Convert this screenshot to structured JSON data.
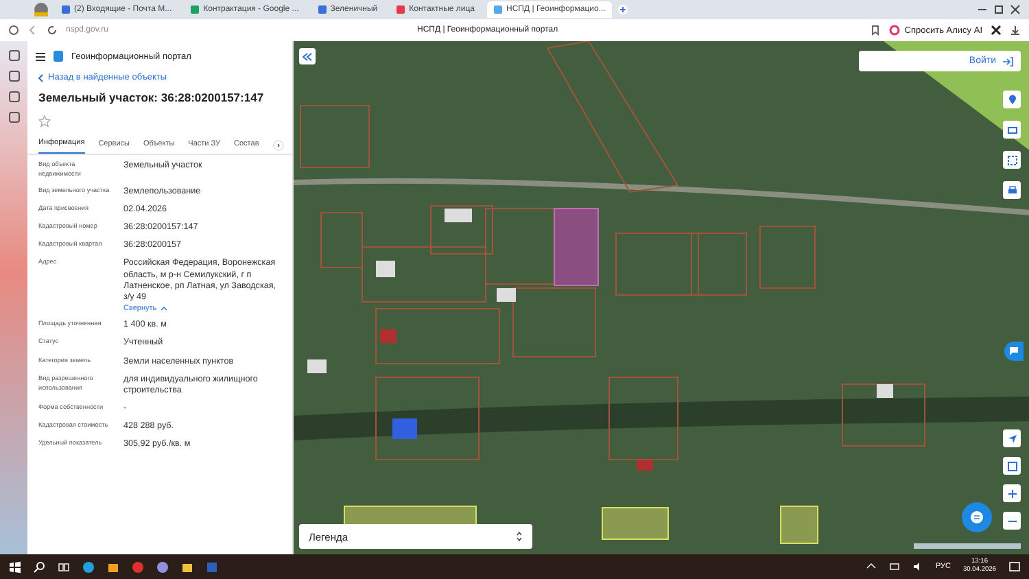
{
  "browser": {
    "tabs": [
      {
        "label": "(2) Входящие - Почта М...",
        "selected": false
      },
      {
        "label": "Контрактация - Google ...",
        "selected": false
      },
      {
        "label": "Зеленичный",
        "selected": false
      },
      {
        "label": "Контактные лица",
        "selected": false
      },
      {
        "label": "НСПД | Геоинформацио...",
        "selected": true
      }
    ],
    "address": "nspd.gov.ru",
    "page_title": "НСПД | Геоинформационный портал",
    "alice_button": "Спросить Алису AI"
  },
  "panel": {
    "portal_title": "Геоинформационный портал",
    "back_link": "Назад в найденные объекты",
    "heading": "Земельный участок: 36:28:0200157:147",
    "favorite": false,
    "tabs": [
      {
        "label": "Информация",
        "selected": true
      },
      {
        "label": "Сервисы",
        "selected": false
      },
      {
        "label": "Объекты",
        "selected": false
      },
      {
        "label": "Части ЗУ",
        "selected": false
      },
      {
        "label": "Состав",
        "selected": false
      }
    ],
    "fields": [
      {
        "label": "Вид объекта недвижимости",
        "value": "Земельный участок"
      },
      {
        "label": "Вид земельного участка",
        "value": "Землепользование"
      },
      {
        "label": "Дата присвоения",
        "value": "02.04.2026"
      },
      {
        "label": "Кадастровый номер",
        "value": "36:28:0200157:147"
      },
      {
        "label": "Кадастровый квартал",
        "value": "36:28:0200157"
      },
      {
        "label": "Адрес",
        "value": "Российская Федерация, Воронежская область, м р-н Семилукский, г п Латненское, рп Латная, ул Заводская, з/у 49",
        "link": "Свернуть"
      },
      {
        "label": "Площадь уточненная",
        "value": "1 400 кв. м"
      },
      {
        "label": "Статус",
        "value": "Учтенный"
      },
      {
        "label": "Категория земель",
        "value": "Земли населенных пунктов"
      },
      {
        "label": "Вид разрешенного использования",
        "value": "для индивидуального жилищного строительства"
      },
      {
        "label": "Форма собственности",
        "value": "-"
      },
      {
        "label": "Кадастровая стоимость",
        "value": "428 288 руб."
      },
      {
        "label": "Удельный показатель",
        "value": "305,92 руб./кв. м"
      }
    ]
  },
  "map": {
    "login_button": "Войти",
    "legend": "Легенда"
  },
  "taskbar": {
    "language": "РУС",
    "time": "13:16",
    "date": "30.04.2026"
  }
}
